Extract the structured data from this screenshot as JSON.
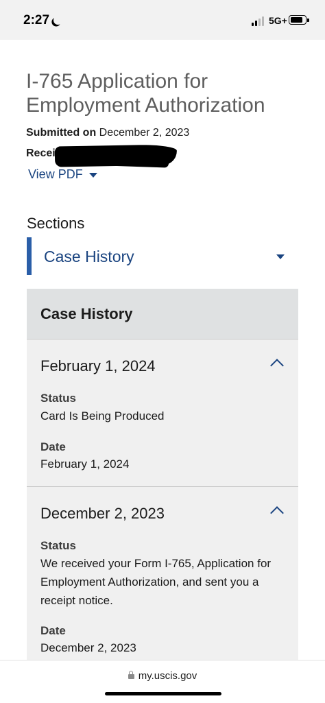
{
  "status_bar": {
    "time": "2:27",
    "network": "5G+"
  },
  "case": {
    "title": "I-765 Application for Employment Authorization",
    "submitted_label": "Submitted on",
    "submitted_date": "December 2, 2023",
    "receipt_label": "Receipt",
    "view_pdf_label": "View PDF"
  },
  "sections": {
    "heading": "Sections",
    "selected": "Case History"
  },
  "case_history": {
    "heading": "Case History",
    "entries": [
      {
        "title": "February 1, 2024",
        "status_label": "Status",
        "status": "Card Is Being Produced",
        "date_label": "Date",
        "date": "February 1, 2024"
      },
      {
        "title": "December 2, 2023",
        "status_label": "Status",
        "status": "We received your Form I-765, Application for Employment Authorization, and sent you a receipt notice.",
        "date_label": "Date",
        "date": "December 2, 2023"
      }
    ]
  },
  "browser": {
    "url": "my.uscis.gov"
  },
  "colors": {
    "accent": "#1a4480",
    "section_bar": "#2a5ea8",
    "panel_bg": "#f0f0f0",
    "panel_header_bg": "#dfe1e2"
  }
}
